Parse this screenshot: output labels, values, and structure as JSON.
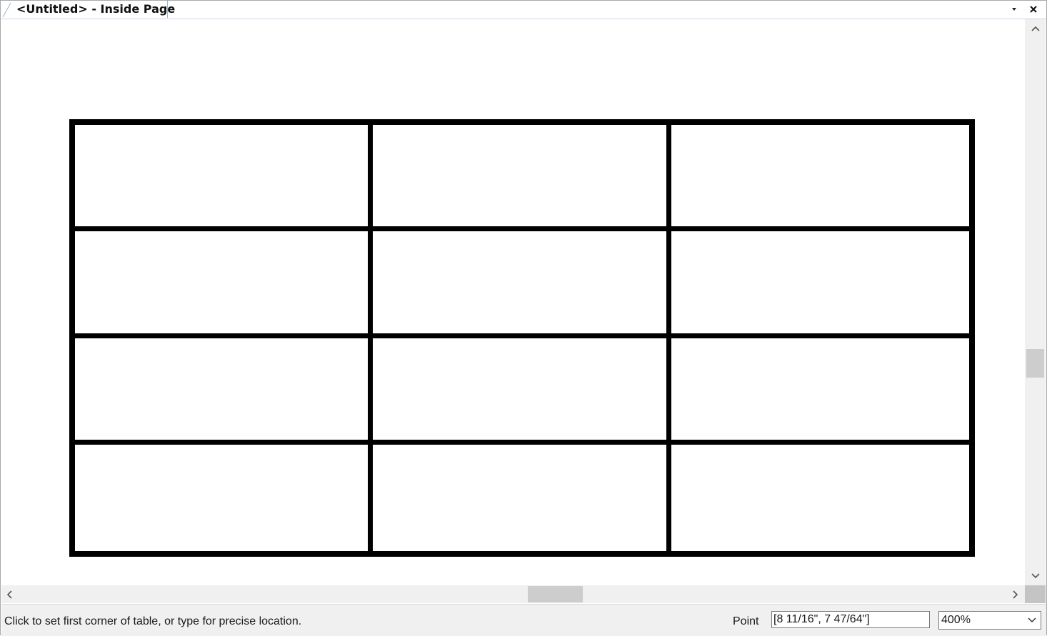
{
  "window": {
    "tab_title": "<Untitled> - Inside Page",
    "dropdown_icon": "chevron-down-icon",
    "close_icon": "close-icon"
  },
  "canvas": {
    "table": {
      "rows": 4,
      "columns": 3,
      "line_color": "#000000"
    }
  },
  "scrollbars": {
    "vertical": {
      "up_icon": "chevron-up-icon",
      "down_icon": "chevron-down-icon"
    },
    "horizontal": {
      "left_icon": "chevron-left-icon",
      "right_icon": "chevron-right-icon"
    }
  },
  "statusbar": {
    "prompt": "Click to set first corner of table, or type for precise location.",
    "point_label": "Point",
    "point_value": "[8 11/16\", 7 47/64\"]",
    "zoom_value": "400%",
    "zoom_arrow_icon": "chevron-down-icon"
  }
}
